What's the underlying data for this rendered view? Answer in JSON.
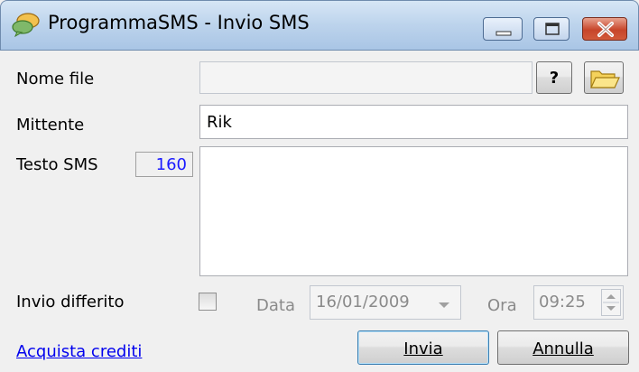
{
  "window": {
    "title": "ProgrammaSMS - Invio SMS",
    "icons": {
      "app": "chat-bubbles-icon",
      "minimize": "minimize-icon",
      "maximize": "maximize-icon",
      "close": "close-icon"
    }
  },
  "form": {
    "file_label": "Nome file",
    "file_value": "",
    "help_label": "?",
    "browse_icon": "folder-open-icon",
    "sender_label": "Mittente",
    "sender_value": "Rik",
    "sms_label": "Testo SMS",
    "sms_counter": "160",
    "sms_value": "",
    "deferred_label": "Invio differito",
    "deferred_checked": false,
    "date_label": "Data",
    "date_value": "16/01/2009",
    "time_label": "Ora",
    "time_value": "09:25"
  },
  "footer": {
    "buy_link": "Acquista crediti",
    "send_button": "Invia",
    "cancel_button": "Annulla"
  },
  "colors": {
    "link": "#0000ee",
    "counter": "#1a1aff",
    "close_button": "#c7452a"
  }
}
